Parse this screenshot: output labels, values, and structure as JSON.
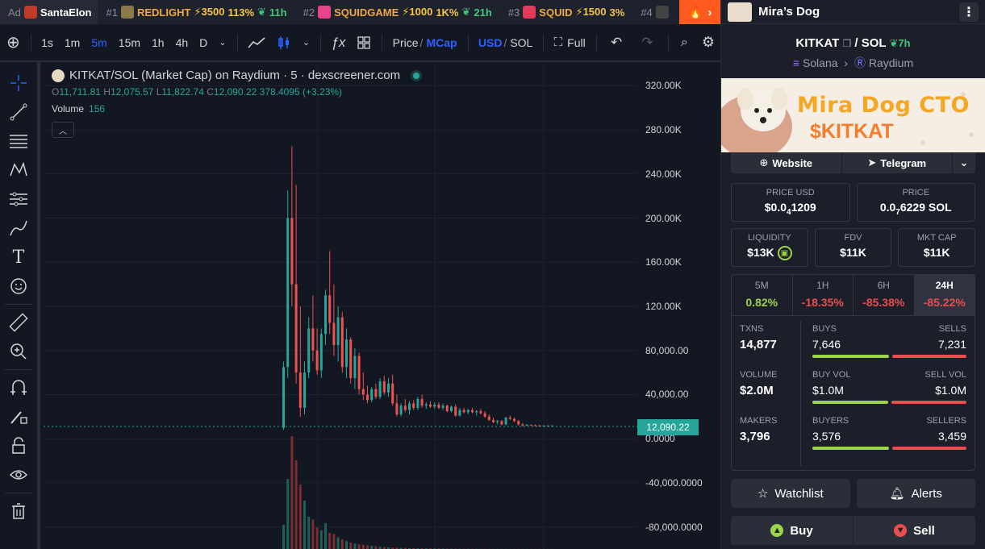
{
  "ticker": {
    "ad_label": "Ad",
    "ad_name": "SantaElon",
    "items": [
      {
        "rank": "#1",
        "name": "REDLIGHT",
        "boost": "⚡3500",
        "pct": "113%",
        "age": "11h",
        "color": "#f0a93a"
      },
      {
        "rank": "#2",
        "name": "SQUIDGAME",
        "boost": "⚡1000",
        "pct": "1K%",
        "age": "21h",
        "color": "#e8438b"
      },
      {
        "rank": "#3",
        "name": "SQUID",
        "boost": "⚡1500",
        "pct": "3%",
        "age": "",
        "color": "#e23a5b"
      },
      {
        "rank": "#4",
        "name": "",
        "boost": "",
        "pct": "",
        "age": "",
        "color": "#555"
      }
    ]
  },
  "toolbar": {
    "intervals": [
      "1s",
      "1m",
      "5m",
      "15m",
      "1h",
      "4h",
      "D"
    ],
    "active_interval": "5m",
    "price_label": "Price",
    "mcap_label": "MCap",
    "usd_label": "USD",
    "sol_label": "SOL",
    "full_label": "Full"
  },
  "chart_header": {
    "title": "KITKAT/SOL (Market Cap) on Raydium · 5 · dexscreener.com",
    "o_label": "O",
    "o": "11,711.81",
    "h_label": "H",
    "h": "12,075.57",
    "l_label": "L",
    "l": "11,822.74",
    "c_label": "C",
    "c": "12,090.22",
    "chg": "378.4095 (+3.23%)",
    "volume_label": "Volume",
    "volume": "156"
  },
  "chart_data": {
    "type": "candlestick",
    "y_ticks": [
      "320.00K",
      "280.00K",
      "240.00K",
      "200.00K",
      "160.00K",
      "120.00K",
      "80,000.00",
      "40,000.00",
      "0.0000",
      "-40,000.0000",
      "-80,000.0000"
    ],
    "last_price": "12,090.22",
    "ylim": [
      -100000,
      340000
    ],
    "candles": [
      [
        0,
        10000,
        70000,
        8000,
        65000
      ],
      [
        1,
        65000,
        225000,
        55000,
        200000
      ],
      [
        2,
        200000,
        265000,
        120000,
        140000
      ],
      [
        3,
        140000,
        230000,
        50000,
        60000
      ],
      [
        4,
        60000,
        120000,
        20000,
        28000
      ],
      [
        5,
        28000,
        70000,
        22000,
        60000
      ],
      [
        6,
        60000,
        110000,
        55000,
        100000
      ],
      [
        7,
        100000,
        130000,
        70000,
        80000
      ],
      [
        8,
        80000,
        100000,
        58000,
        62000
      ],
      [
        9,
        62000,
        100000,
        55000,
        95000
      ],
      [
        10,
        95000,
        135000,
        85000,
        130000
      ],
      [
        11,
        130000,
        170000,
        95000,
        105000
      ],
      [
        12,
        105000,
        140000,
        75000,
        85000
      ],
      [
        13,
        85000,
        120000,
        70000,
        110000
      ],
      [
        14,
        110000,
        115000,
        60000,
        65000
      ],
      [
        15,
        65000,
        100000,
        55000,
        90000
      ],
      [
        16,
        90000,
        92000,
        50000,
        55000
      ],
      [
        17,
        55000,
        82000,
        45000,
        75000
      ],
      [
        18,
        75000,
        78000,
        40000,
        45000
      ],
      [
        19,
        45000,
        60000,
        35000,
        40000
      ],
      [
        20,
        40000,
        48000,
        32000,
        35000
      ],
      [
        21,
        35000,
        47000,
        33000,
        45000
      ],
      [
        22,
        45000,
        50000,
        36000,
        38000
      ],
      [
        23,
        38000,
        55000,
        36000,
        52000
      ],
      [
        24,
        52000,
        57000,
        40000,
        42000
      ],
      [
        25,
        42000,
        55000,
        38000,
        50000
      ],
      [
        26,
        50000,
        58000,
        30000,
        32000
      ],
      [
        27,
        32000,
        40000,
        20000,
        22000
      ],
      [
        28,
        22000,
        32000,
        20000,
        30000
      ],
      [
        29,
        30000,
        36000,
        24000,
        26000
      ],
      [
        30,
        26000,
        34000,
        22000,
        32000
      ],
      [
        31,
        32000,
        35000,
        26000,
        28000
      ],
      [
        32,
        28000,
        38000,
        26000,
        36000
      ],
      [
        33,
        36000,
        40000,
        28000,
        30000
      ],
      [
        34,
        30000,
        33000,
        27000,
        31000
      ],
      [
        35,
        31000,
        34000,
        28000,
        29000
      ],
      [
        36,
        29000,
        33000,
        27000,
        31000
      ],
      [
        37,
        31000,
        33000,
        27000,
        28000
      ],
      [
        38,
        28000,
        32000,
        26000,
        30000
      ],
      [
        39,
        30000,
        31000,
        24000,
        25000
      ],
      [
        40,
        25000,
        30000,
        24000,
        29000
      ],
      [
        41,
        29000,
        31000,
        20000,
        21000
      ],
      [
        42,
        21000,
        28000,
        20000,
        26000
      ],
      [
        43,
        26000,
        28000,
        23000,
        24000
      ],
      [
        44,
        24000,
        27000,
        22000,
        26000
      ],
      [
        45,
        26000,
        28000,
        23000,
        24000
      ],
      [
        46,
        24000,
        26000,
        21000,
        25000
      ],
      [
        47,
        25000,
        27000,
        22000,
        23000
      ],
      [
        48,
        23000,
        25000,
        19000,
        20000
      ],
      [
        49,
        20000,
        22000,
        16000,
        17000
      ],
      [
        50,
        17000,
        19000,
        14000,
        15000
      ],
      [
        51,
        15000,
        17000,
        13000,
        16000
      ],
      [
        52,
        16000,
        17000,
        12000,
        13000
      ],
      [
        53,
        13000,
        20000,
        12000,
        19000
      ],
      [
        54,
        19000,
        21000,
        17000,
        18000
      ],
      [
        55,
        18000,
        19000,
        15000,
        16000
      ],
      [
        56,
        16000,
        17000,
        12000,
        13000
      ],
      [
        57,
        13000,
        14000,
        11000,
        12000
      ],
      [
        58,
        12000,
        13500,
        11500,
        12500
      ],
      [
        59,
        12500,
        13000,
        11800,
        12200
      ],
      [
        60,
        12200,
        12800,
        11600,
        12000
      ],
      [
        61,
        12000,
        12500,
        11000,
        11500
      ],
      [
        62,
        11500,
        12200,
        11000,
        11900
      ],
      [
        63,
        11900,
        12300,
        11600,
        11800
      ],
      [
        64,
        11711,
        12075,
        11822,
        12090
      ]
    ],
    "volumes": [
      45000,
      130000,
      210000,
      165000,
      120000,
      90000,
      60000,
      55000,
      40000,
      35000,
      48000,
      30000,
      28000,
      22000,
      18000,
      15000,
      12000,
      10000,
      9000,
      8000,
      7000,
      6000,
      5000,
      4000,
      3500,
      3000,
      2800,
      2500,
      2200,
      2000,
      1800,
      1500,
      1400,
      1300,
      1200,
      1100,
      1000,
      900,
      800,
      700,
      600,
      500,
      450,
      400,
      350,
      300,
      280,
      250,
      220,
      200,
      180,
      170,
      160,
      150,
      150,
      150,
      150,
      150,
      150,
      150,
      150,
      150,
      150,
      150,
      156
    ]
  },
  "panel": {
    "title": "Mira’s Dog",
    "pair_base": "KITKAT",
    "pair_quote": "SOL",
    "pair_age": "7h",
    "chain": "Solana",
    "dex": "Raydium",
    "banner_line1": "Mira Dog CTO",
    "banner_line2": "$KITKAT",
    "website_label": "Website",
    "telegram_label": "Telegram",
    "price_usd_label": "PRICE USD",
    "price_usd_main": "$0.0",
    "price_usd_sub": "4",
    "price_usd_tail": "1209",
    "price_sol_label": "PRICE",
    "price_sol_main": "0.0",
    "price_sol_sub": "7",
    "price_sol_tail": "6229 SOL",
    "liq_label": "LIQUIDITY",
    "liq": "$13K",
    "fdv_label": "FDV",
    "fdv": "$11K",
    "mcap_label": "MKT CAP",
    "mcap": "$11K",
    "timeframes": [
      {
        "label": "5M",
        "value": "0.82%",
        "color": "#9bd34a"
      },
      {
        "label": "1H",
        "value": "-18.35%",
        "color": "#ea4d4d"
      },
      {
        "label": "6H",
        "value": "-85.38%",
        "color": "#ea4d4d"
      },
      {
        "label": "24H",
        "value": "-85.22%",
        "color": "#ea4d4d"
      }
    ],
    "txns_label": "TXNS",
    "txns": "14,877",
    "buys_label": "BUYS",
    "buys": "7,646",
    "sells_label": "SELLS",
    "sells": "7,231",
    "volume_label": "VOLUME",
    "volume": "$2.0M",
    "buyvol_label": "BUY VOL",
    "buyvol": "$1.0M",
    "sellvol_label": "SELL VOL",
    "sellvol": "$1.0M",
    "makers_label": "MAKERS",
    "makers": "3,796",
    "buyers_label": "BUYERS",
    "buyers": "3,576",
    "sellers_label": "SELLERS",
    "sellers": "3,459",
    "watchlist_label": "Watchlist",
    "alerts_label": "Alerts",
    "buy_label": "Buy",
    "sell_label": "Sell"
  }
}
